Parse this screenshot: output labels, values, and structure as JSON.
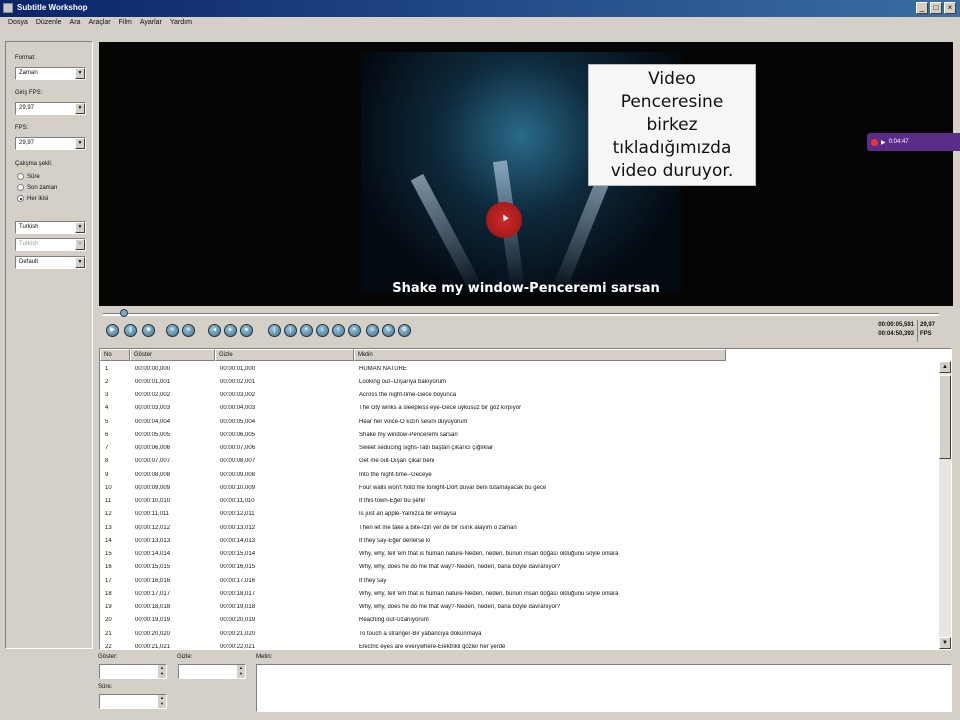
{
  "window": {
    "title": "Subtitle Workshop",
    "buttons": [
      "_",
      "□",
      "×"
    ]
  },
  "menu": [
    "Dosya",
    "Düzenle",
    "Ara",
    "Araçlar",
    "Film",
    "Ayarlar",
    "Yardım"
  ],
  "left_panel": {
    "format_label": "Format:",
    "format_value": "Zaman",
    "input_fps_label": "Giriş FPS:",
    "input_fps_value": "29,97",
    "fps_label": "FPS:",
    "fps_value": "29,97",
    "mode_label": "Çalışma şekli:",
    "mode_options": [
      {
        "label": "Süre",
        "selected": false
      },
      {
        "label": "Son zaman",
        "selected": false
      },
      {
        "label": "Her ikisi",
        "selected": true
      }
    ],
    "lang1_value": "Turkish",
    "lang2_value": "Turkish",
    "charset_value": "Default"
  },
  "video": {
    "subtitle": "Shake my window-Penceremi sarsan",
    "callout_lines": [
      "Video",
      "Penceresine",
      "birkez",
      "tıkladığımızda",
      "video duruyor."
    ],
    "overlay_time": "0:04:47"
  },
  "player": {
    "current_time": "00:00:05,591",
    "total_time": "00:04:50,393",
    "fps_value": "29,97",
    "fps_label": "FPS"
  },
  "table": {
    "columns": [
      "No",
      "Göster",
      "Gizle",
      "Metin"
    ],
    "rows": [
      [
        "1",
        "00:00:00,000",
        "00:00:01,000",
        "HUMAN NATURE"
      ],
      [
        "2",
        "00:00:01,001",
        "00:00:02,001",
        "Looking out--Dışarıya bakıyorum"
      ],
      [
        "3",
        "00:00:02,002",
        "00:00:03,002",
        "Across the night-time-Gece boyunca"
      ],
      [
        "4",
        "00:00:03,003",
        "00:00:04,003",
        "The city winks a sleepless eye-Gece uykusuz bir göz kırpıyor"
      ],
      [
        "5",
        "00:00:04,004",
        "00:00:05,004",
        "Hear her voice-O kızın sesini duyuyorum"
      ],
      [
        "6",
        "00:00:05,005",
        "00:00:06,005",
        "Shake my window-Penceremi sarsan"
      ],
      [
        "7",
        "00:00:06,006",
        "00:00:07,006",
        "Sweet seducing sighs-Tatlı baştan çıkarıcı çığlıklar"
      ],
      [
        "8",
        "00:00:07,007",
        "00:00:08,007",
        "Get me out-Dışarı çıkar beni"
      ],
      [
        "9",
        "00:00:08,008",
        "00:00:09,008",
        "Into the night-time--Geceye"
      ],
      [
        "10",
        "00:00:09,009",
        "00:00:10,009",
        "Four walls won't hold me tonight-Dört duvar beni tutamayacak bu gece"
      ],
      [
        "11",
        "00:00:10,010",
        "00:00:11,010",
        "If this town-Eğer bu şehir"
      ],
      [
        "12",
        "00:00:11,011",
        "00:00:12,011",
        "Is just an apple-Yalnızca bir elmaysa"
      ],
      [
        "13",
        "00:00:12,012",
        "00:00:13,012",
        "Then let me take a bite-İzin ver de bir ısırık alayım o zaman"
      ],
      [
        "14",
        "00:00:13,013",
        "00:00:14,013",
        "If they say-Eğer derlerse ki"
      ],
      [
        "15",
        "00:00:14,014",
        "00:00:15,014",
        "Why, why, tell 'em that is human nature-Neden, neden, bunun insan doğası olduğunu söyle onlara"
      ],
      [
        "16",
        "00:00:15,015",
        "00:00:16,015",
        "Why, why, does he do me that way?-Neden, neden, bana böyle davranıyor?"
      ],
      [
        "17",
        "00:00:16,016",
        "00:00:17,016",
        "If they say"
      ],
      [
        "18",
        "00:00:17,017",
        "00:00:18,017",
        "Why, why, tell 'em that is human nature-Neden, neden, bunun insan doğası olduğunu söyle onlara"
      ],
      [
        "19",
        "00:00:18,018",
        "00:00:19,018",
        "Why, why, does he do me that way?-Neden, neden, bana böyle davranıyor?"
      ],
      [
        "20",
        "00:00:19,019",
        "00:00:20,019",
        "Reaching out-Uzanıyorum"
      ],
      [
        "21",
        "00:00:20,020",
        "00:00:21,020",
        "To touch a stranger-Bir yabancıya dokunmaya"
      ],
      [
        "22",
        "00:00:21,021",
        "00:00:22,021",
        "Electric eyes are everywhere-Elektrikli gözler her yerde"
      ]
    ]
  },
  "bottom": {
    "show_label": "Göster:",
    "hide_label": "Gizle:",
    "duration_label": "Süre:",
    "text_label": "Metin:"
  }
}
